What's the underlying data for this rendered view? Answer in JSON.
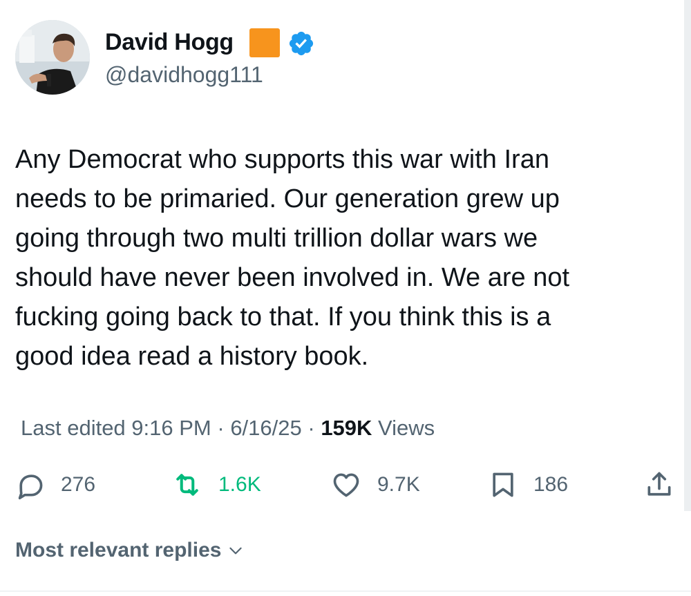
{
  "author": {
    "display_name": "David Hogg",
    "name_emoji": "🟧",
    "handle": "@davidhogg111",
    "verified": true,
    "verified_color": "#1d9bf0"
  },
  "tweet": {
    "text_lines": [
      "Any Democrat who supports this war with Iran",
      "needs to be primaried. Our generation grew up",
      "going through two multi trillion dollar wars we",
      "should have never been involved in. We are not",
      "fucking going back to that. If you think this is a",
      "good idea read a history book."
    ]
  },
  "meta": {
    "edited_label": "Last edited",
    "time": "9:16 PM",
    "separator": " · ",
    "date": "6/16/25",
    "separator2": " · ",
    "views_count": "159K",
    "views_label": "Views"
  },
  "actions": {
    "reply": {
      "icon": "reply-icon",
      "count": "276"
    },
    "retweet": {
      "icon": "retweet-icon",
      "count": "1.6K",
      "color": "#00ba7c"
    },
    "like": {
      "icon": "heart-icon",
      "count": "9.7K"
    },
    "bookmark": {
      "icon": "bookmark-icon",
      "count": "186"
    },
    "share": {
      "icon": "share-icon"
    }
  },
  "replies_filter": {
    "label": "Most relevant replies"
  },
  "colors": {
    "text": "#0f1419",
    "secondary": "#536471",
    "orange": "#f7941d"
  }
}
